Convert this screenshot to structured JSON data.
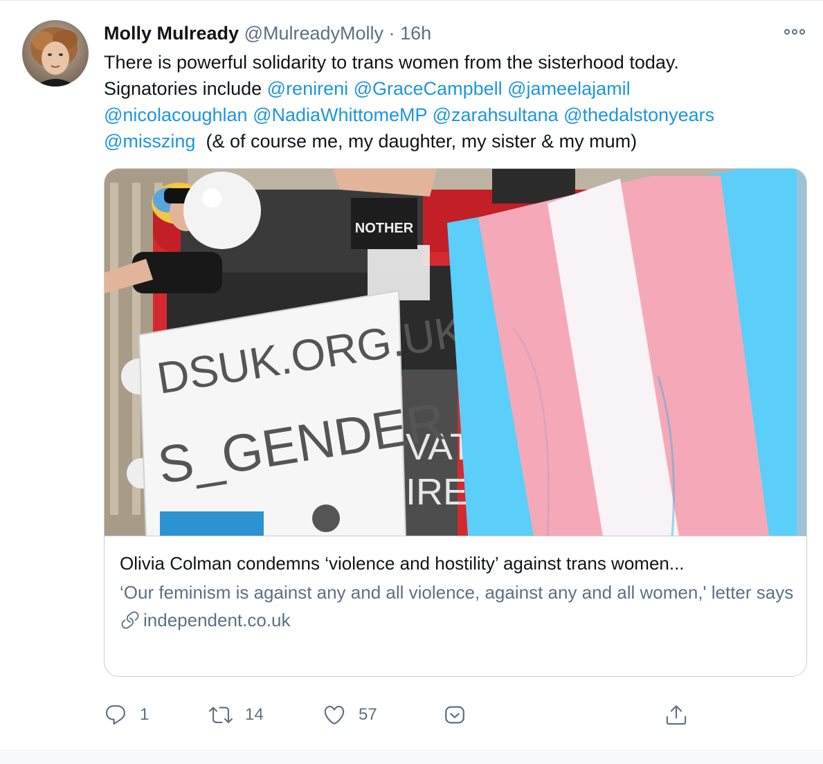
{
  "tweet": {
    "author": {
      "name": "Molly Mulready",
      "handle": "@MulreadyMolly",
      "separator": "·",
      "time": "16h"
    },
    "text": {
      "line1": "There is powerful solidarity to trans women from the sisterhood today.",
      "line2_prefix": "Signatories include ",
      "mentions": [
        "@renireni",
        "@GraceCampbell",
        "@jameelajamil",
        "@nicolacoughlan",
        "@NadiaWhittomeMP",
        "@zarahsultana",
        "@thedalstonyears",
        "@misszing"
      ],
      "line4_suffix": "(& of course me, my daughter, my sister & my mum)"
    },
    "card": {
      "banner_text_1": "DSUK.ORG.UK",
      "banner_text_2": "S_GENDER",
      "bus_text_1": "VAT",
      "bus_text_2": "IRE",
      "sign_text": "NOTHER",
      "title": "Olivia Colman condemns ‘violence and hostility’ against trans women...",
      "description": "‘Our feminism is against any and all violence, against any and all women,' letter says",
      "domain": "independent.co.uk"
    },
    "actions": {
      "reply_count": "1",
      "retweet_count": "14",
      "like_count": "57"
    }
  },
  "colors": {
    "link": "#1b95e0",
    "secondary_text": "#5b7083",
    "border": "#c4cfd6",
    "flag_blue": "#5bcefa",
    "flag_pink": "#f5a9b8",
    "bus_red": "#d42a2f"
  },
  "icons": [
    "more-icon",
    "link-icon",
    "reply-icon",
    "retweet-icon",
    "like-icon",
    "dm-icon",
    "share-icon"
  ]
}
